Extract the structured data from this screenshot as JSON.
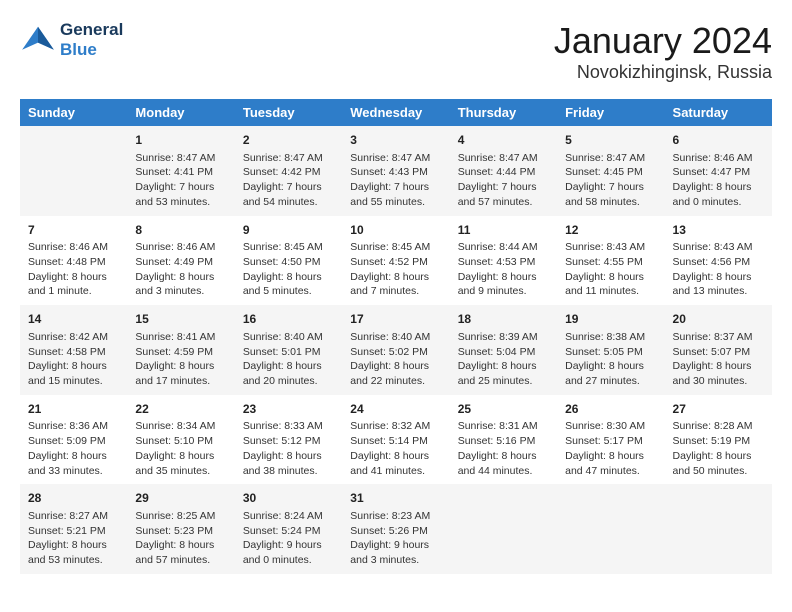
{
  "header": {
    "logo_line1": "General",
    "logo_line2": "Blue",
    "month": "January 2024",
    "location": "Novokizhinginsk, Russia"
  },
  "days_of_week": [
    "Sunday",
    "Monday",
    "Tuesday",
    "Wednesday",
    "Thursday",
    "Friday",
    "Saturday"
  ],
  "weeks": [
    [
      {
        "num": "",
        "info": ""
      },
      {
        "num": "1",
        "info": "Sunrise: 8:47 AM\nSunset: 4:41 PM\nDaylight: 7 hours\nand 53 minutes."
      },
      {
        "num": "2",
        "info": "Sunrise: 8:47 AM\nSunset: 4:42 PM\nDaylight: 7 hours\nand 54 minutes."
      },
      {
        "num": "3",
        "info": "Sunrise: 8:47 AM\nSunset: 4:43 PM\nDaylight: 7 hours\nand 55 minutes."
      },
      {
        "num": "4",
        "info": "Sunrise: 8:47 AM\nSunset: 4:44 PM\nDaylight: 7 hours\nand 57 minutes."
      },
      {
        "num": "5",
        "info": "Sunrise: 8:47 AM\nSunset: 4:45 PM\nDaylight: 7 hours\nand 58 minutes."
      },
      {
        "num": "6",
        "info": "Sunrise: 8:46 AM\nSunset: 4:47 PM\nDaylight: 8 hours\nand 0 minutes."
      }
    ],
    [
      {
        "num": "7",
        "info": "Sunrise: 8:46 AM\nSunset: 4:48 PM\nDaylight: 8 hours\nand 1 minute."
      },
      {
        "num": "8",
        "info": "Sunrise: 8:46 AM\nSunset: 4:49 PM\nDaylight: 8 hours\nand 3 minutes."
      },
      {
        "num": "9",
        "info": "Sunrise: 8:45 AM\nSunset: 4:50 PM\nDaylight: 8 hours\nand 5 minutes."
      },
      {
        "num": "10",
        "info": "Sunrise: 8:45 AM\nSunset: 4:52 PM\nDaylight: 8 hours\nand 7 minutes."
      },
      {
        "num": "11",
        "info": "Sunrise: 8:44 AM\nSunset: 4:53 PM\nDaylight: 8 hours\nand 9 minutes."
      },
      {
        "num": "12",
        "info": "Sunrise: 8:43 AM\nSunset: 4:55 PM\nDaylight: 8 hours\nand 11 minutes."
      },
      {
        "num": "13",
        "info": "Sunrise: 8:43 AM\nSunset: 4:56 PM\nDaylight: 8 hours\nand 13 minutes."
      }
    ],
    [
      {
        "num": "14",
        "info": "Sunrise: 8:42 AM\nSunset: 4:58 PM\nDaylight: 8 hours\nand 15 minutes."
      },
      {
        "num": "15",
        "info": "Sunrise: 8:41 AM\nSunset: 4:59 PM\nDaylight: 8 hours\nand 17 minutes."
      },
      {
        "num": "16",
        "info": "Sunrise: 8:40 AM\nSunset: 5:01 PM\nDaylight: 8 hours\nand 20 minutes."
      },
      {
        "num": "17",
        "info": "Sunrise: 8:40 AM\nSunset: 5:02 PM\nDaylight: 8 hours\nand 22 minutes."
      },
      {
        "num": "18",
        "info": "Sunrise: 8:39 AM\nSunset: 5:04 PM\nDaylight: 8 hours\nand 25 minutes."
      },
      {
        "num": "19",
        "info": "Sunrise: 8:38 AM\nSunset: 5:05 PM\nDaylight: 8 hours\nand 27 minutes."
      },
      {
        "num": "20",
        "info": "Sunrise: 8:37 AM\nSunset: 5:07 PM\nDaylight: 8 hours\nand 30 minutes."
      }
    ],
    [
      {
        "num": "21",
        "info": "Sunrise: 8:36 AM\nSunset: 5:09 PM\nDaylight: 8 hours\nand 33 minutes."
      },
      {
        "num": "22",
        "info": "Sunrise: 8:34 AM\nSunset: 5:10 PM\nDaylight: 8 hours\nand 35 minutes."
      },
      {
        "num": "23",
        "info": "Sunrise: 8:33 AM\nSunset: 5:12 PM\nDaylight: 8 hours\nand 38 minutes."
      },
      {
        "num": "24",
        "info": "Sunrise: 8:32 AM\nSunset: 5:14 PM\nDaylight: 8 hours\nand 41 minutes."
      },
      {
        "num": "25",
        "info": "Sunrise: 8:31 AM\nSunset: 5:16 PM\nDaylight: 8 hours\nand 44 minutes."
      },
      {
        "num": "26",
        "info": "Sunrise: 8:30 AM\nSunset: 5:17 PM\nDaylight: 8 hours\nand 47 minutes."
      },
      {
        "num": "27",
        "info": "Sunrise: 8:28 AM\nSunset: 5:19 PM\nDaylight: 8 hours\nand 50 minutes."
      }
    ],
    [
      {
        "num": "28",
        "info": "Sunrise: 8:27 AM\nSunset: 5:21 PM\nDaylight: 8 hours\nand 53 minutes."
      },
      {
        "num": "29",
        "info": "Sunrise: 8:25 AM\nSunset: 5:23 PM\nDaylight: 8 hours\nand 57 minutes."
      },
      {
        "num": "30",
        "info": "Sunrise: 8:24 AM\nSunset: 5:24 PM\nDaylight: 9 hours\nand 0 minutes."
      },
      {
        "num": "31",
        "info": "Sunrise: 8:23 AM\nSunset: 5:26 PM\nDaylight: 9 hours\nand 3 minutes."
      },
      {
        "num": "",
        "info": ""
      },
      {
        "num": "",
        "info": ""
      },
      {
        "num": "",
        "info": ""
      }
    ]
  ]
}
